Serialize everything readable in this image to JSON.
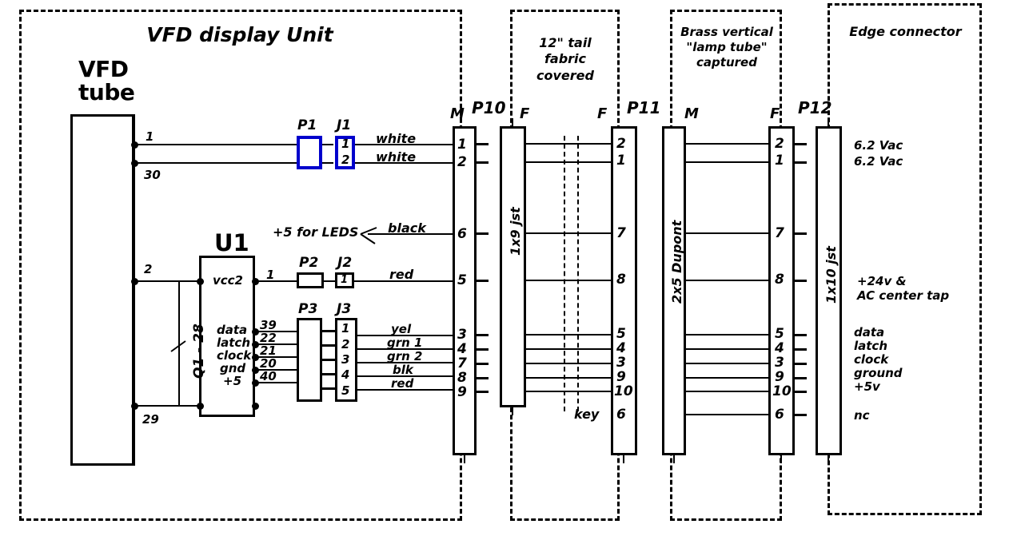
{
  "diagram": {
    "title": "VFD display Unit wiring diagram",
    "zones": [
      {
        "id": "vfd-display-unit",
        "title": "VFD display Unit"
      },
      {
        "id": "tail-fabric",
        "title": "12\" tail\nfabric\ncovered"
      },
      {
        "id": "brass-lamp-tube",
        "title": "Brass vertical\n\"lamp tube\"\ncaptured"
      },
      {
        "id": "edge-connector",
        "title": "Edge connector"
      }
    ],
    "vfd_tube": {
      "label": "VFD\ntube",
      "pins": [
        "1",
        "30",
        "2",
        "29"
      ]
    },
    "u1": {
      "label": "U1",
      "left_note": "Q1 - 28",
      "power_pin_label": "vcc2",
      "power_pin_number": "1",
      "signal_pins": [
        {
          "name": "data",
          "number": "39"
        },
        {
          "name": "latch",
          "number": "22"
        },
        {
          "name": "clock",
          "number": "21"
        },
        {
          "name": "gnd",
          "number": "20"
        },
        {
          "name": "+5",
          "number": "40"
        }
      ]
    },
    "leds_note": "+5 for LEDS",
    "inline_connectors": [
      {
        "plug": "P1",
        "jack": "J1",
        "jack_pins": [
          "1",
          "2"
        ]
      },
      {
        "plug": "P2",
        "jack": "J2",
        "jack_pins": [
          "1"
        ]
      },
      {
        "plug": "P3",
        "jack": "J3",
        "jack_pins": [
          "1",
          "2",
          "3",
          "4",
          "5"
        ]
      }
    ],
    "wire_colors": [
      "white",
      "white",
      "black",
      "red",
      "yel",
      "grn 1",
      "grn 2",
      "blk",
      "red"
    ],
    "key_label": "key",
    "connectors": [
      {
        "name": "P10",
        "male_label": "M",
        "female_label": "F",
        "type": "1x9 jst",
        "male_pins": [
          "1",
          "2",
          "6",
          "5",
          "3",
          "4",
          "7",
          "8",
          "9"
        ],
        "female_pins": []
      },
      {
        "name": "P11",
        "male_label": "M",
        "female_label": "F",
        "type": "2x5 Dupont",
        "female_pins": [
          "2",
          "1",
          "7",
          "8",
          "5",
          "4",
          "3",
          "9",
          "10",
          "6"
        ],
        "male_pins": []
      },
      {
        "name": "P12",
        "female_label": "F",
        "type": "1x10 jst",
        "female_pins": [
          "2",
          "1",
          "7",
          "8",
          "5",
          "4",
          "3",
          "9",
          "10",
          "6"
        ]
      }
    ],
    "edge_signals": [
      "6.2 Vac",
      "6.2 Vac",
      "+24v &\nAC center tap",
      "data",
      "latch",
      "clock",
      "ground",
      "+5v",
      "nc"
    ],
    "colors": {
      "ink": "#000000",
      "accent_blue": "#0000cc",
      "background": "#ffffff"
    }
  }
}
